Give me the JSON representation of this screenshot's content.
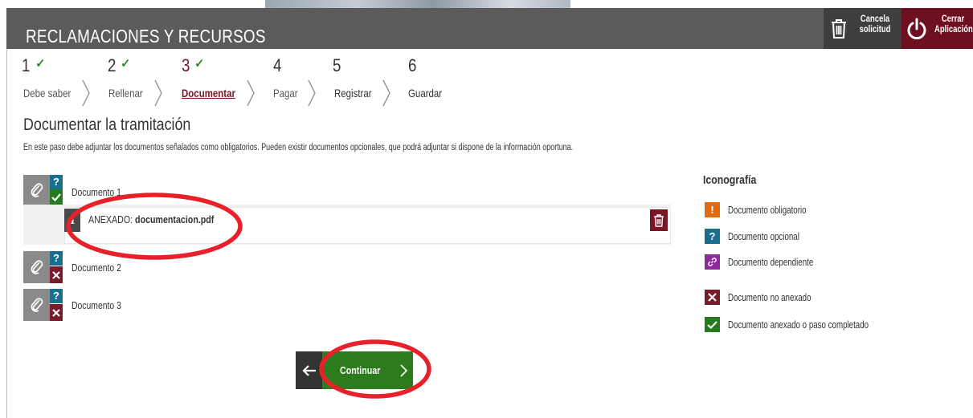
{
  "header": {
    "title": "RECLAMACIONES Y RECURSOS",
    "cancel_label": "Cancela solicitud",
    "close_label": "Cerrar Aplicación"
  },
  "steps": [
    {
      "number": "1",
      "label": "Debe saber",
      "completed": true
    },
    {
      "number": "2",
      "label": "Rellenar",
      "completed": true
    },
    {
      "number": "3",
      "label": "Documentar",
      "completed": true,
      "active": true
    },
    {
      "number": "4",
      "label": "Pagar",
      "completed": false
    },
    {
      "number": "5",
      "label": "Registrar",
      "completed": false
    },
    {
      "number": "6",
      "label": "Guardar",
      "completed": false
    }
  ],
  "section": {
    "title": "Documentar la tramitación",
    "description": "En este paso debe adjuntar los documentos señalados como obligatorios. Pueden existir documentos opcionales, que podrá adjuntar si dispone de la información oportuna."
  },
  "documents": [
    {
      "label": "Documento 1",
      "status": "anexado",
      "attachment_prefix": "ANEXADO: ",
      "attachment_file": "documentacion.pdf"
    },
    {
      "label": "Documento 2",
      "status": "no anexado"
    },
    {
      "label": "Documento 3",
      "status": "no anexado"
    }
  ],
  "legend": {
    "title": "Iconografía",
    "items": [
      {
        "label": "Documento obligatorio",
        "color": "#e06a10",
        "icon": "exclamation-icon"
      },
      {
        "label": "Documento opcional",
        "color": "#1a6e8e",
        "icon": "question-icon"
      },
      {
        "label": "Documento dependiente",
        "color": "#8e2a9e",
        "icon": "link-icon"
      },
      {
        "label": "Documento no anexado",
        "color": "#7a1a2b",
        "icon": "cross-icon"
      },
      {
        "label": "Documento anexado o paso completado",
        "color": "#237a1f",
        "icon": "check-icon"
      }
    ]
  },
  "actions": {
    "continue_label": "Continuar"
  },
  "colors": {
    "header_bg": "#5b5b5b",
    "accent": "#7a1526",
    "success": "#2c7c1e",
    "annotation": "#e8202a"
  }
}
